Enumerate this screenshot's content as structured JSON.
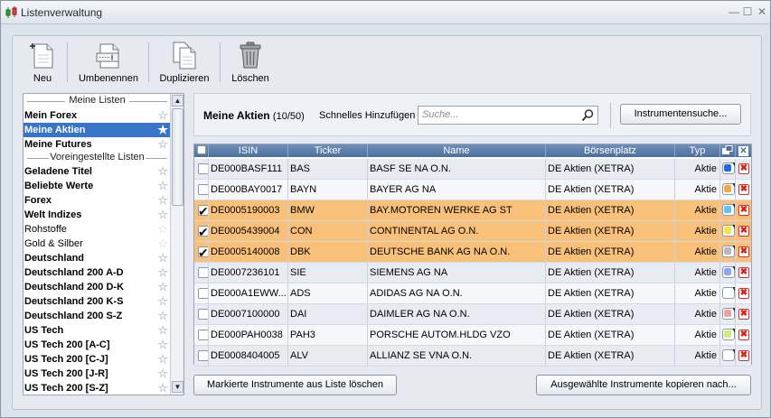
{
  "window": {
    "title": "Listenverwaltung",
    "controls": [
      "—",
      "☐",
      "✕"
    ]
  },
  "toolbar": {
    "new_label": "Neu",
    "rename_label": "Umbenennen",
    "duplicate_label": "Duplizieren",
    "delete_label": "Löschen"
  },
  "lists": {
    "my_lists_header": "Meine Listen",
    "preset_header": "Voreingestellte Listen",
    "my_lists": [
      {
        "label": "Mein Forex",
        "bold": true,
        "selected": false
      },
      {
        "label": "Meine Aktien",
        "bold": true,
        "selected": true
      },
      {
        "label": "Meine Futures",
        "bold": true,
        "selected": false
      }
    ],
    "preset_lists": [
      {
        "label": "Geladene Titel",
        "bold": true
      },
      {
        "label": "Beliebte Werte",
        "bold": true
      },
      {
        "label": "Forex",
        "bold": true
      },
      {
        "label": "Welt Indizes",
        "bold": true
      },
      {
        "label": "Rohstoffe",
        "bold": false
      },
      {
        "label": "Gold & Silber",
        "bold": false
      },
      {
        "label": "Deutschland",
        "bold": true
      },
      {
        "label": "Deutschland 200 A-D",
        "bold": true
      },
      {
        "label": "Deutschland 200 D-K",
        "bold": true
      },
      {
        "label": "Deutschland 200 K-S",
        "bold": true
      },
      {
        "label": "Deutschland 200 S-Z",
        "bold": true
      },
      {
        "label": "US Tech",
        "bold": true
      },
      {
        "label": "US Tech 200 [A-C]",
        "bold": true
      },
      {
        "label": "US Tech 200 [C-J]",
        "bold": true
      },
      {
        "label": "US Tech 200 [J-R]",
        "bold": true
      },
      {
        "label": "US Tech 200 [S-Z]",
        "bold": true
      }
    ]
  },
  "main": {
    "list_title": "Meine Aktien",
    "list_count": "(10/50)",
    "quick_add_label": "Schnelles Hinzufügen",
    "search_placeholder": "Suche...",
    "instrument_search_button": "Instrumentensuche...",
    "columns": [
      "ISIN",
      "Ticker",
      "Name",
      "Börsenplatz",
      "Typ"
    ],
    "rows": [
      {
        "isin": "DE000BASF111",
        "ticker": "BAS",
        "name": "BASF SE NA O.N.",
        "exchange": "DE Aktien (XETRA)",
        "type": "Aktie",
        "checked": false,
        "color": "#1e6ad8"
      },
      {
        "isin": "DE000BAY0017",
        "ticker": "BAYN",
        "name": "BAYER AG  NA",
        "exchange": "DE Aktien (XETRA)",
        "type": "Aktie",
        "checked": false,
        "color": "#f3a840"
      },
      {
        "isin": "DE0005190003",
        "ticker": "BMW",
        "name": "BAY.MOTOREN WERKE AG ST",
        "exchange": "DE Aktien (XETRA)",
        "type": "Aktie",
        "checked": true,
        "color": "#5fc4f0"
      },
      {
        "isin": "DE0005439004",
        "ticker": "CON",
        "name": "CONTINENTAL AG O.N.",
        "exchange": "DE Aktien (XETRA)",
        "type": "Aktie",
        "checked": true,
        "color": "#f5e642"
      },
      {
        "isin": "DE0005140008",
        "ticker": "DBK",
        "name": "DEUTSCHE BANK AG NA O.N.",
        "exchange": "DE Aktien (XETRA)",
        "type": "Aktie",
        "checked": true,
        "color": "#b9b9b9"
      },
      {
        "isin": "DE0007236101",
        "ticker": "SIE",
        "name": "SIEMENS AG NA",
        "exchange": "DE Aktien (XETRA)",
        "type": "Aktie",
        "checked": false,
        "color": "#8aa8f0"
      },
      {
        "isin": "DE000A1EWW...",
        "ticker": "ADS",
        "name": "ADIDAS AG NA O.N.",
        "exchange": "DE Aktien (XETRA)",
        "type": "Aktie",
        "checked": false,
        "color": "#ffffff"
      },
      {
        "isin": "DE0007100000",
        "ticker": "DAI",
        "name": "DAIMLER AG NA O.N.",
        "exchange": "DE Aktien (XETRA)",
        "type": "Aktie",
        "checked": false,
        "color": "#f0a0a0"
      },
      {
        "isin": "DE000PAH0038",
        "ticker": "PAH3",
        "name": "PORSCHE AUTOM.HLDG VZO",
        "exchange": "DE Aktien (XETRA)",
        "type": "Aktie",
        "checked": false,
        "color": "#c8f07a"
      },
      {
        "isin": "DE0008404005",
        "ticker": "ALV",
        "name": "ALLIANZ SE VNA O.N.",
        "exchange": "DE Aktien (XETRA)",
        "type": "Aktie",
        "checked": false,
        "color": "#ffffff"
      }
    ],
    "delete_marked_button": "Markierte Instrumente aus Liste löschen",
    "copy_selected_button": "Ausgewählte Instrumente kopieren nach..."
  }
}
